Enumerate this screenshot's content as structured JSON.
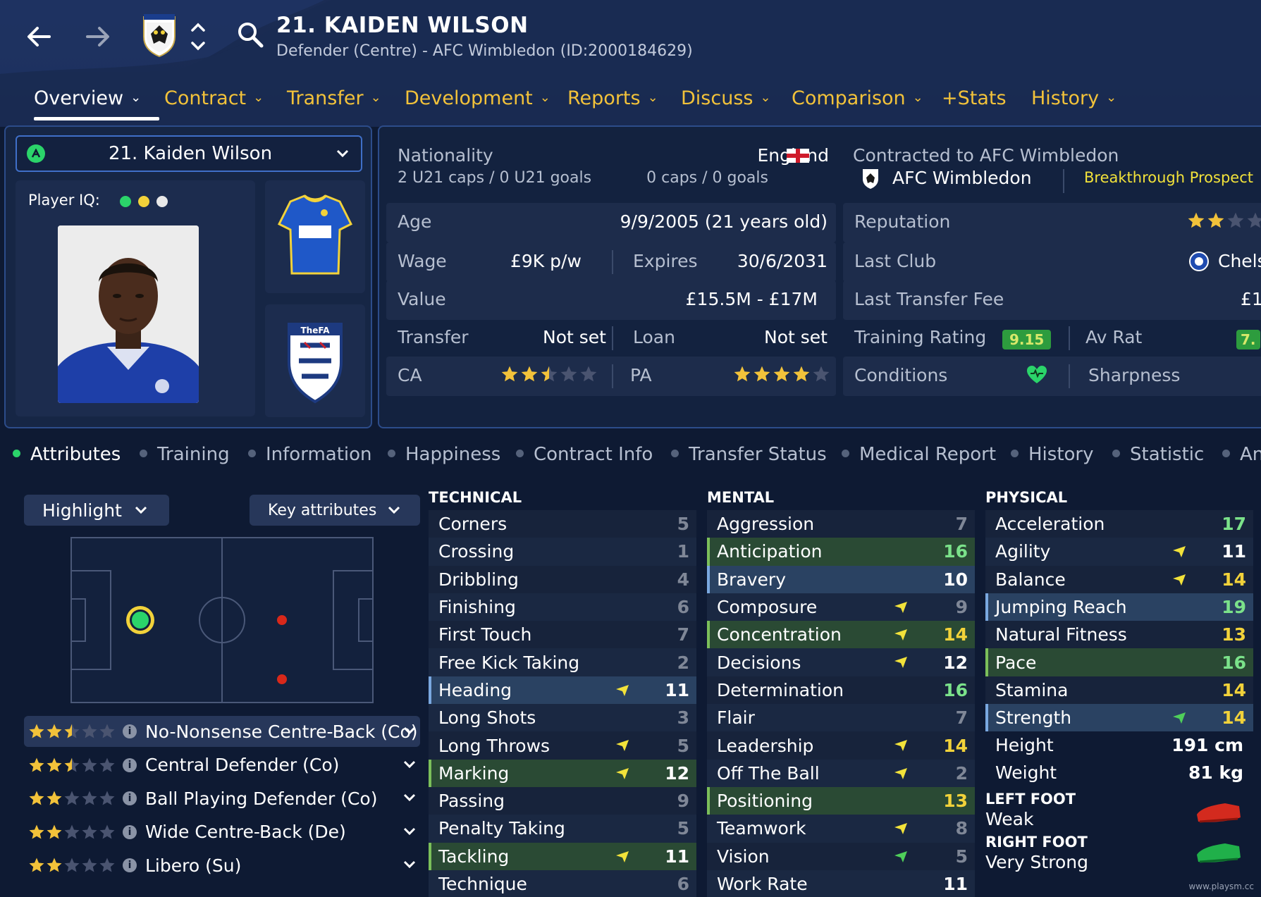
{
  "header": {
    "title": "21. KAIDEN WILSON",
    "subtitle": "Defender (Centre) - AFC Wimbledon (ID:2000184629)"
  },
  "tabs": [
    {
      "label": "Overview",
      "dropdown": true,
      "active": true
    },
    {
      "label": "Contract",
      "dropdown": true
    },
    {
      "label": "Transfer",
      "dropdown": true
    },
    {
      "label": "Development",
      "dropdown": true
    },
    {
      "label": "Reports",
      "dropdown": true
    },
    {
      "label": "Discuss",
      "dropdown": true
    },
    {
      "label": "Comparison",
      "dropdown": true
    },
    {
      "label": "+Stats",
      "dropdown": false
    },
    {
      "label": "History",
      "dropdown": true
    }
  ],
  "player_select": {
    "name": "21. Kaiden Wilson"
  },
  "player_iq": {
    "label": "Player IQ:",
    "dots": [
      "#2bd46a",
      "#f2d23a",
      "#e8e8e8"
    ]
  },
  "info": {
    "nationality_label": "Nationality",
    "nationality": "England",
    "u21": "2 U21 caps / 0 U21 goals",
    "caps": "0 caps / 0 goals",
    "contracted_label": "Contracted to AFC Wimbledon",
    "club": "AFC Wimbledon",
    "prospect": "Breakthrough Prospect",
    "age_label": "Age",
    "age": "9/9/2005 (21 years old)",
    "reputation_label": "Reputation",
    "reputation_stars": 2,
    "wage_label": "Wage",
    "wage": "£9K p/w",
    "expires_label": "Expires",
    "expires": "30/6/2031",
    "last_club_label": "Last Club",
    "last_club": "Chels",
    "value_label": "Value",
    "value": "£15.5M - £17M",
    "last_fee_label": "Last Transfer Fee",
    "last_fee": "£1.",
    "transfer_label": "Transfer",
    "transfer": "Not set",
    "loan_label": "Loan",
    "loan": "Not set",
    "training_label": "Training Rating",
    "training": "9.15",
    "avrat_label": "Av Rat",
    "avrat": "7.",
    "ca_label": "CA",
    "ca_stars": 2.5,
    "pa_label": "PA",
    "pa_stars": 4,
    "conditions_label": "Conditions",
    "sharpness_label": "Sharpness"
  },
  "subtabs": [
    {
      "label": "Attributes",
      "active": true
    },
    {
      "label": "Training"
    },
    {
      "label": "Information"
    },
    {
      "label": "Happiness"
    },
    {
      "label": "Contract Info"
    },
    {
      "label": "Transfer Status"
    },
    {
      "label": "Medical Report"
    },
    {
      "label": "History"
    },
    {
      "label": "Statistic"
    },
    {
      "label": "An"
    }
  ],
  "controls": {
    "highlight": "Highlight",
    "key_attributes": "Key attributes"
  },
  "roles": [
    {
      "stars": 2.5,
      "name": "No-Nonsense Centre-Back (Co)",
      "selected": true
    },
    {
      "stars": 2.5,
      "name": "Central Defender (Co)"
    },
    {
      "stars": 2,
      "name": "Ball Playing Defender (Co)"
    },
    {
      "stars": 2,
      "name": "Wide Centre-Back (De)"
    },
    {
      "stars": 2,
      "name": "Libero (Su)"
    }
  ],
  "technical": {
    "title": "TECHNICAL",
    "items": [
      {
        "name": "Corners",
        "value": "5",
        "color": "grey"
      },
      {
        "name": "Crossing",
        "value": "1",
        "color": "grey"
      },
      {
        "name": "Dribbling",
        "value": "4",
        "color": "grey"
      },
      {
        "name": "Finishing",
        "value": "6",
        "color": "grey"
      },
      {
        "name": "First Touch",
        "value": "7",
        "color": "grey"
      },
      {
        "name": "Free Kick Taking",
        "value": "2",
        "color": "grey"
      },
      {
        "name": "Heading",
        "value": "11",
        "color": "white",
        "hl": "blue",
        "arrow": "yellow"
      },
      {
        "name": "Long Shots",
        "value": "3",
        "color": "grey"
      },
      {
        "name": "Long Throws",
        "value": "5",
        "color": "grey",
        "arrow": "yellow"
      },
      {
        "name": "Marking",
        "value": "12",
        "color": "white",
        "hl": "green",
        "arrow": "yellow"
      },
      {
        "name": "Passing",
        "value": "9",
        "color": "grey"
      },
      {
        "name": "Penalty Taking",
        "value": "5",
        "color": "grey"
      },
      {
        "name": "Tackling",
        "value": "11",
        "color": "white",
        "hl": "green",
        "arrow": "yellow"
      },
      {
        "name": "Technique",
        "value": "6",
        "color": "grey"
      }
    ]
  },
  "mental": {
    "title": "MENTAL",
    "items": [
      {
        "name": "Aggression",
        "value": "7",
        "color": "grey"
      },
      {
        "name": "Anticipation",
        "value": "16",
        "color": "lgreen",
        "hl": "green"
      },
      {
        "name": "Bravery",
        "value": "10",
        "color": "white",
        "hl": "blue"
      },
      {
        "name": "Composure",
        "value": "9",
        "color": "grey",
        "arrow": "yellow"
      },
      {
        "name": "Concentration",
        "value": "14",
        "color": "yellow",
        "hl": "green",
        "arrow": "yellow"
      },
      {
        "name": "Decisions",
        "value": "12",
        "color": "white",
        "arrow": "yellow"
      },
      {
        "name": "Determination",
        "value": "16",
        "color": "lgreen"
      },
      {
        "name": "Flair",
        "value": "7",
        "color": "grey"
      },
      {
        "name": "Leadership",
        "value": "14",
        "color": "yellow",
        "arrow": "yellow"
      },
      {
        "name": "Off The Ball",
        "value": "2",
        "color": "grey",
        "arrow": "yellow"
      },
      {
        "name": "Positioning",
        "value": "13",
        "color": "yellow",
        "hl": "green"
      },
      {
        "name": "Teamwork",
        "value": "8",
        "color": "grey",
        "arrow": "yellow"
      },
      {
        "name": "Vision",
        "value": "5",
        "color": "grey",
        "arrow": "green"
      },
      {
        "name": "Work Rate",
        "value": "11",
        "color": "white"
      }
    ]
  },
  "physical": {
    "title": "PHYSICAL",
    "items": [
      {
        "name": "Acceleration",
        "value": "17",
        "color": "lgreen"
      },
      {
        "name": "Agility",
        "value": "11",
        "color": "white",
        "arrow": "yellow"
      },
      {
        "name": "Balance",
        "value": "14",
        "color": "yellow",
        "arrow": "yellow"
      },
      {
        "name": "Jumping Reach",
        "value": "19",
        "color": "lgreen",
        "hl": "blue"
      },
      {
        "name": "Natural Fitness",
        "value": "13",
        "color": "yellow"
      },
      {
        "name": "Pace",
        "value": "16",
        "color": "lgreen",
        "hl": "green"
      },
      {
        "name": "Stamina",
        "value": "14",
        "color": "yellow"
      },
      {
        "name": "Strength",
        "value": "14",
        "color": "yellow",
        "hl": "blue",
        "arrow": "green"
      }
    ],
    "height_label": "Height",
    "height": "191 cm",
    "weight_label": "Weight",
    "weight": "81 kg",
    "left_foot_label": "LEFT FOOT",
    "left_foot": "Weak",
    "right_foot_label": "RIGHT FOOT",
    "right_foot": "Very Strong"
  },
  "colors": {
    "accent": "#f2c23a",
    "selected": "#2bd46a",
    "panel_border": "#2c4c8a"
  },
  "watermark": "www.playsm.cc"
}
